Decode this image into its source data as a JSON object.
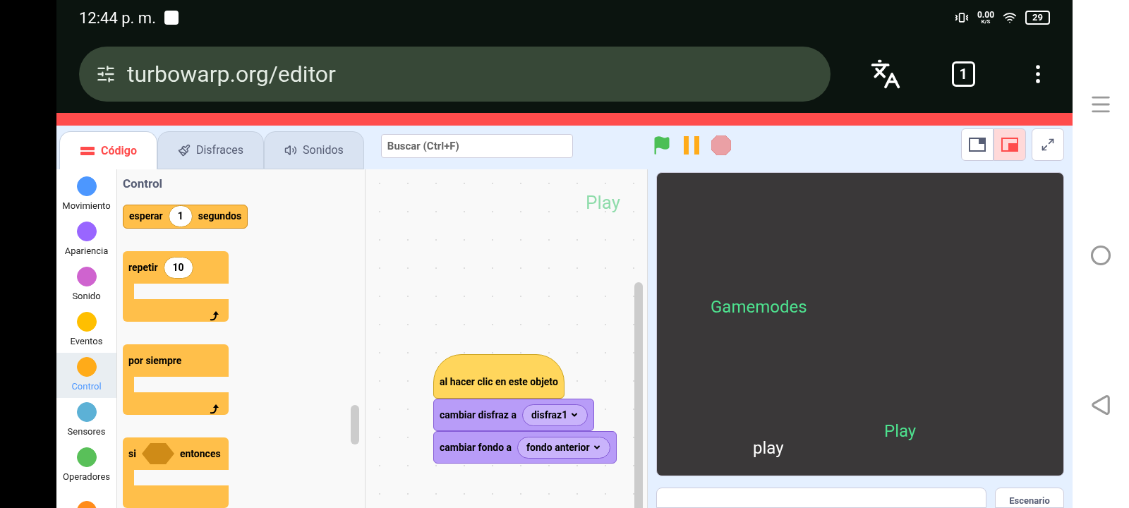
{
  "status_bar": {
    "time": "12:44 p. m.",
    "net_speed": "0.00",
    "net_unit": "K/S",
    "battery": "29"
  },
  "browser": {
    "url": "turbowarp.org/editor",
    "tab_count": "1"
  },
  "tabs": [
    {
      "label": "Código",
      "selected": true,
      "kind": "code"
    },
    {
      "label": "Disfraces",
      "selected": false,
      "kind": "costumes"
    },
    {
      "label": "Sonidos",
      "selected": false,
      "kind": "sounds"
    }
  ],
  "search": {
    "placeholder": "Buscar (Ctrl+F)"
  },
  "stage_layouts": [
    {
      "kind": "small",
      "selected": false
    },
    {
      "kind": "large",
      "selected": true
    }
  ],
  "categories": [
    {
      "label": "Movimiento",
      "color": "#4c97ff",
      "selected": false
    },
    {
      "label": "Apariencia",
      "color": "#9966ff",
      "selected": false
    },
    {
      "label": "Sonido",
      "color": "#cf63cf",
      "selected": false
    },
    {
      "label": "Eventos",
      "color": "#ffbf00",
      "selected": false
    },
    {
      "label": "Control",
      "color": "#ffab19",
      "selected": true
    },
    {
      "label": "Sensores",
      "color": "#5cb1d6",
      "selected": false
    },
    {
      "label": "Operadores",
      "color": "#59c059",
      "selected": false
    },
    {
      "color": "#ff8c1a",
      "selected": false
    }
  ],
  "palette": {
    "title": "Control",
    "blocks": [
      {
        "kind": "stack",
        "before": "esperar",
        "input": "1",
        "after": "segundos"
      },
      {
        "kind": "c",
        "before": "repetir",
        "input": "10"
      },
      {
        "kind": "c",
        "before": "por siempre"
      },
      {
        "kind": "if",
        "before": "si",
        "after": "entonces"
      }
    ]
  },
  "canvas": {
    "comment": "Play",
    "script": [
      {
        "kind": "hat",
        "text": "al hacer clic en este objeto"
      },
      {
        "kind": "looks",
        "text": "cambiar disfraz a",
        "menu": "disfraz1"
      },
      {
        "kind": "looks",
        "text": "cambiar fondo a",
        "menu": "fondo anterior"
      }
    ]
  },
  "stage": {
    "texts": [
      {
        "text": "Gamemodes",
        "color": "#4ee28f"
      },
      {
        "text": "Play",
        "color": "#4ee28f"
      },
      {
        "text": "play",
        "color": "#ffffff"
      }
    ]
  },
  "stage_panel": {
    "label": "Escenario"
  }
}
